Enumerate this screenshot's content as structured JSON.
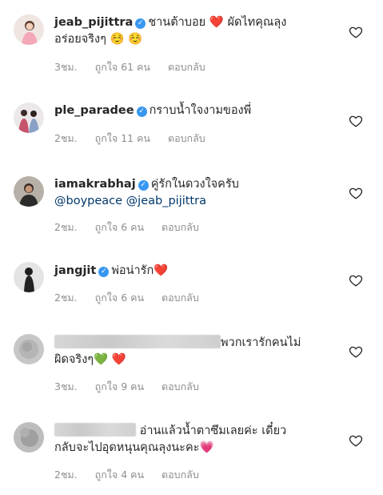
{
  "comments": [
    {
      "username": "jeab_pijittra",
      "text_line1": "ชานต้าบอย",
      "text_line1_after": "ผัดไทคุณลุง",
      "text_line2": "อร่อยจริงๆ",
      "emoji_heart": "❤️",
      "emoji_smiles": "☺️ ☺️",
      "time": "3ชม.",
      "likes": "ถูกใจ 61 คน",
      "reply": "ตอบกลับ"
    },
    {
      "username": "ple_paradee",
      "text": "กราบน้ำใจงามของพี่",
      "time": "2ชม.",
      "likes": "ถูกใจ 11 คน",
      "reply": "ตอบกลับ"
    },
    {
      "username": "iamakrabhaj",
      "text": "คู่รักในดวงใจครับ",
      "mentions": "@boypeace @jeab_pijittra",
      "time": "2ชม.",
      "likes": "ถูกใจ 6 คน",
      "reply": "ตอบกลับ"
    },
    {
      "username": "jangjit",
      "text": "พ่อน่ารัก",
      "emoji_heart": "❤️",
      "time": "2ชม.",
      "likes": "ถูกใจ 6 คน",
      "reply": "ตอบกลับ"
    },
    {
      "text_line1": "พวกเรารักคนไม่",
      "text_line2": "ผิดจริงๆ",
      "emoji_green": "💚",
      "emoji_heart": "❤️",
      "time": "3ชม.",
      "likes": "ถูกใจ 9 คน",
      "reply": "ตอบกลับ"
    },
    {
      "text_line1": "อ่านแล้วน้ำตาซึมเลยค่ะ เดี๋ยว",
      "text_line2": "กลับจะไปอุดหนุนคุณลุงนะคะ",
      "emoji_pink": "💗",
      "time": "2ชม.",
      "likes": "ถูกใจ 4 คน",
      "reply": "ตอบกลับ"
    }
  ],
  "colors": {
    "text": "#262626",
    "meta": "#8e8e8e",
    "verified": "#3897f0",
    "mention": "#00376b"
  }
}
